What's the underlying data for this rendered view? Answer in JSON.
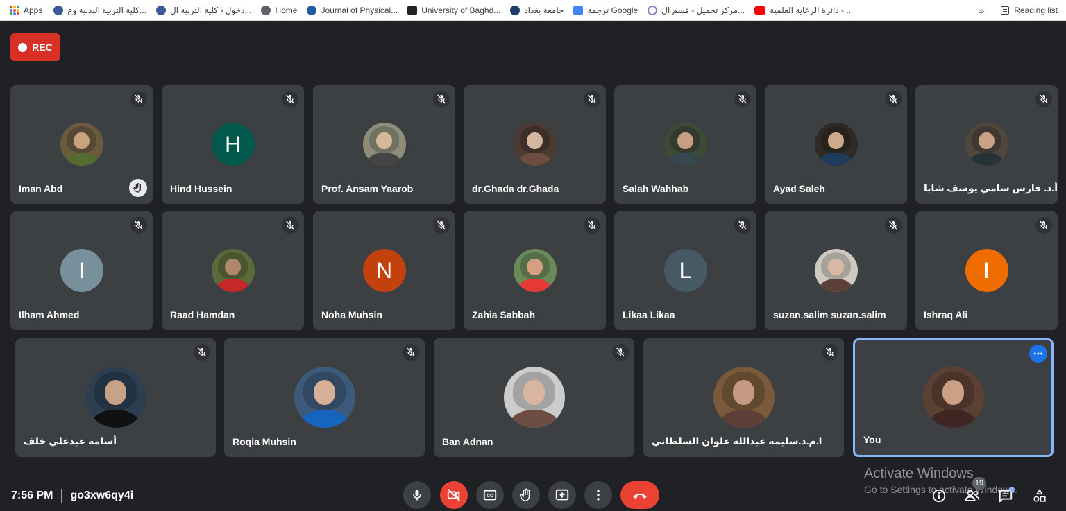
{
  "bookmarks": {
    "items": [
      {
        "label": "Apps",
        "icon": "apps-icon"
      },
      {
        "label": "كلية التربية البدنية وع...",
        "icon": "college-logo-icon"
      },
      {
        "label": "دخول ‹ كلية التربية ال...",
        "icon": "college-logo-icon"
      },
      {
        "label": "Home",
        "icon": "globe-icon"
      },
      {
        "label": "Journal of Physical...",
        "icon": "journal-logo-icon"
      },
      {
        "label": "University of Baghd...",
        "icon": "university-logo-icon"
      },
      {
        "label": "جامعة بغداد",
        "icon": "university-seal-icon"
      },
      {
        "label": "ترجمة Google",
        "icon": "google-translate-icon"
      },
      {
        "label": "مركز تحميل - قسم ال...",
        "icon": "upload-center-icon"
      },
      {
        "label": "دائرة الرعاية العلمية -...",
        "icon": "youtube-icon"
      }
    ],
    "overflow": "»",
    "reading_list": "Reading list"
  },
  "rec_label": "REC",
  "participants": [
    {
      "name": "Iman Abd",
      "avatar": "photo",
      "muted": true,
      "hand_raised": true
    },
    {
      "name": "Hind Hussein",
      "avatar": "letter",
      "initial": "H",
      "color": "#00594c",
      "muted": true
    },
    {
      "name": "Prof. Ansam Yaarob",
      "avatar": "photo",
      "muted": true
    },
    {
      "name": "dr.Ghada dr.Ghada",
      "avatar": "photo",
      "muted": true
    },
    {
      "name": "Salah Wahhab",
      "avatar": "photo",
      "muted": true
    },
    {
      "name": "Ayad Saleh",
      "avatar": "photo",
      "muted": true
    },
    {
      "name": "أ.د. فارس سامي يوسف شابا",
      "avatar": "photo",
      "muted": true
    },
    {
      "name": "Ilham Ahmed",
      "avatar": "letter",
      "initial": "I",
      "color": "#78909c",
      "muted": true
    },
    {
      "name": "Raad Hamdan",
      "avatar": "photo",
      "muted": true
    },
    {
      "name": "Noha Muhsin",
      "avatar": "letter",
      "initial": "N",
      "color": "#c2410c",
      "muted": true
    },
    {
      "name": "Zahia Sabbah",
      "avatar": "photo",
      "muted": true
    },
    {
      "name": "Likaa Likaa",
      "avatar": "letter",
      "initial": "L",
      "color": "#455a64",
      "muted": true
    },
    {
      "name": "suzan.salim suzan.salim",
      "avatar": "photo",
      "muted": true
    },
    {
      "name": "Ishraq Ali",
      "avatar": "letter",
      "initial": "I",
      "color": "#ef6c00",
      "muted": true
    },
    {
      "name": "أسامة عبدعلي خلف",
      "avatar": "photo",
      "muted": true
    },
    {
      "name": "Roqia Muhsin",
      "avatar": "photo",
      "muted": true
    },
    {
      "name": "Ban Adnan",
      "avatar": "photo",
      "muted": true
    },
    {
      "name": "ا.م.د.سليمة عبدالله علوان السلطاني",
      "avatar": "photo",
      "muted": true
    },
    {
      "name": "You",
      "avatar": "photo",
      "muted": false,
      "self": true
    }
  ],
  "meeting": {
    "time": "7:56 PM",
    "code": "go3xw6qy4i",
    "people_count": "19"
  },
  "controls": [
    {
      "name": "microphone-button",
      "icon": "mic-icon"
    },
    {
      "name": "camera-off-button",
      "icon": "camera-off-icon"
    },
    {
      "name": "captions-button",
      "icon": "captions-icon"
    },
    {
      "name": "raise-hand-button",
      "icon": "hand-icon"
    },
    {
      "name": "present-button",
      "icon": "present-icon"
    },
    {
      "name": "more-options-button",
      "icon": "more-vert-icon"
    },
    {
      "name": "leave-call-button",
      "icon": "end-call-icon"
    }
  ],
  "watermark": {
    "line1": "Activate Windows",
    "line2": "Go to Settings to activate Windows."
  },
  "colors": {
    "background": "#202124",
    "tile": "#3c4043",
    "rec": "#d93025",
    "end_call": "#ea4335",
    "self_border": "#8ab4f8"
  }
}
